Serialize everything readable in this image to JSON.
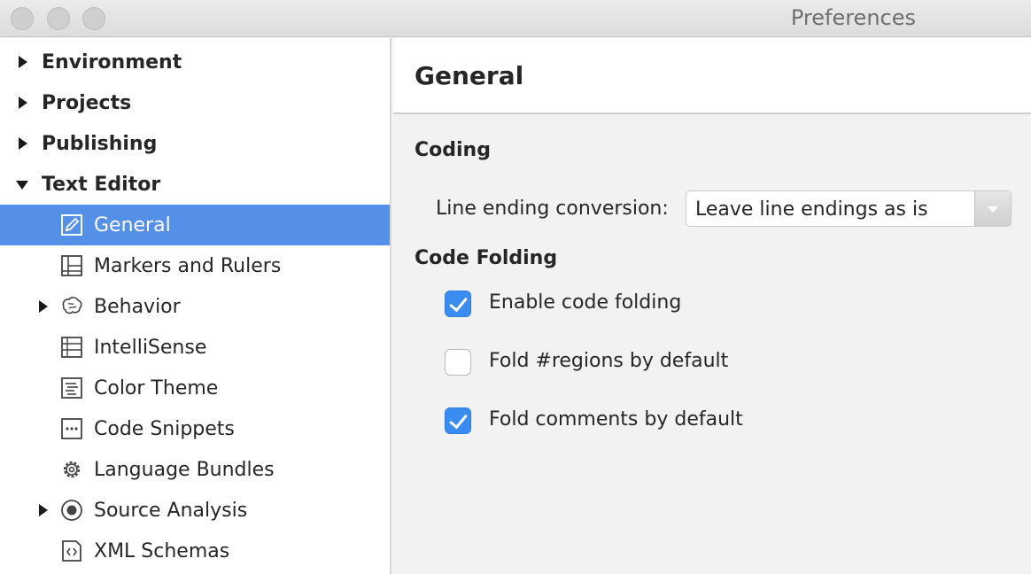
{
  "window": {
    "title": "Preferences"
  },
  "sidebar": {
    "items": [
      {
        "label": "Environment",
        "level": 0,
        "expanded": false,
        "icon": ""
      },
      {
        "label": "Projects",
        "level": 0,
        "expanded": false,
        "icon": ""
      },
      {
        "label": "Publishing",
        "level": 0,
        "expanded": false,
        "icon": ""
      },
      {
        "label": "Text Editor",
        "level": 0,
        "expanded": true,
        "icon": ""
      },
      {
        "label": "General",
        "level": 1,
        "selected": true,
        "icon": "pencil-icon"
      },
      {
        "label": "Markers and Rulers",
        "level": 1,
        "icon": "grid-icon"
      },
      {
        "label": "Behavior",
        "level": 1,
        "expandable": true,
        "icon": "brain-icon"
      },
      {
        "label": "IntelliSense",
        "level": 1,
        "icon": "list-icon"
      },
      {
        "label": "Color Theme",
        "level": 1,
        "icon": "document-lines-icon"
      },
      {
        "label": "Code Snippets",
        "level": 1,
        "icon": "snippet-icon"
      },
      {
        "label": "Language Bundles",
        "level": 1,
        "icon": "gear-icon"
      },
      {
        "label": "Source Analysis",
        "level": 1,
        "expandable": true,
        "icon": "target-icon"
      },
      {
        "label": "XML Schemas",
        "level": 1,
        "icon": "code-file-icon"
      }
    ]
  },
  "main": {
    "title": "General",
    "coding": {
      "heading": "Coding",
      "line_ending_label": "Line ending conversion:",
      "line_ending_value": "Leave line endings as is"
    },
    "folding": {
      "heading": "Code Folding",
      "options": [
        {
          "label": "Enable code folding",
          "checked": true
        },
        {
          "label": "Fold #regions by default",
          "checked": false
        },
        {
          "label": "Fold comments by default",
          "checked": true
        }
      ]
    }
  },
  "colors": {
    "selection": "#5590e8",
    "checkbox_accent": "#3b8cf0"
  }
}
